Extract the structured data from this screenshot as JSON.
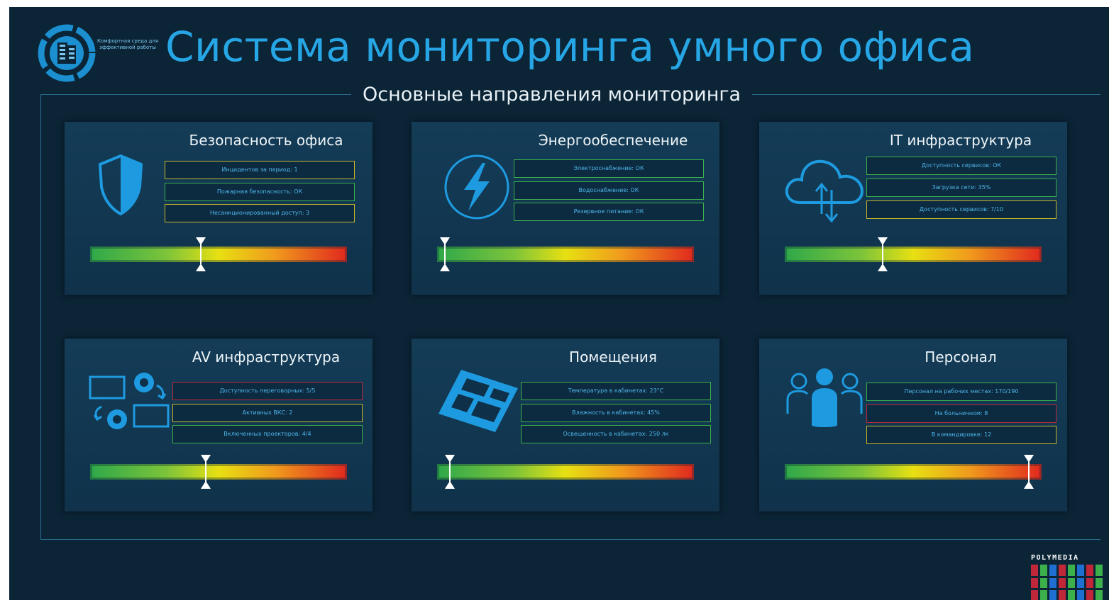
{
  "header": {
    "title": "Система мониторинга умного офиса",
    "subtitle": "Основные направления мониторинга",
    "logo_text": "Комфортная среда для эффективной работы"
  },
  "cards": [
    {
      "title": "Безопасность офиса",
      "icon": "shield-icon",
      "metrics": [
        {
          "text": "Инцидентов за период: 1",
          "status": "yellow"
        },
        {
          "text": "Пожарная безопасность: ОК",
          "status": "green"
        },
        {
          "text": "Несанкционированный доступ: 3",
          "status": "yellow"
        }
      ],
      "level": 0.43
    },
    {
      "title": "Энергообеспечение",
      "icon": "lightning-icon",
      "metrics": [
        {
          "text": "Электроснабжение: ОК",
          "status": "green"
        },
        {
          "text": "Водоснабжение: ОК",
          "status": "green"
        },
        {
          "text": "Резервное питание: ОК",
          "status": "green"
        }
      ],
      "level": 0.03
    },
    {
      "title": "IT инфраструктура",
      "icon": "cloud-sync-icon",
      "metrics": [
        {
          "text": "Доступность сервисов: ОК",
          "status": "green"
        },
        {
          "text": "Загрузка сети: 35%",
          "status": "green"
        },
        {
          "text": "Доступность сервисов: 7/10",
          "status": "yellow"
        }
      ],
      "level": 0.38
    },
    {
      "title": "AV инфраструктура",
      "icon": "av-devices-icon",
      "metrics": [
        {
          "text": "Доступность переговорных: 5/5",
          "status": "red"
        },
        {
          "text": "Активных ВКС: 2",
          "status": "yellow"
        },
        {
          "text": "Включенных проекторов: 4/4",
          "status": "green"
        }
      ],
      "level": 0.45
    },
    {
      "title": "Помещения",
      "icon": "floorplan-icon",
      "metrics": [
        {
          "text": "Температура в кабинетах: 23°C",
          "status": "green"
        },
        {
          "text": "Влажность в кабинетах: 45%",
          "status": "green"
        },
        {
          "text": "Освещенность в кабинетах: 250 лк",
          "status": "green"
        }
      ],
      "level": 0.05
    },
    {
      "title": "Персонал",
      "icon": "people-icon",
      "metrics": [
        {
          "text": "Персонал на рабочих местах: 170/190",
          "status": "green"
        },
        {
          "text": "На больничном: 8",
          "status": "red"
        },
        {
          "text": "В командировке: 12",
          "status": "yellow"
        }
      ],
      "level": 0.95
    }
  ],
  "status_colors": {
    "green": "#3cb04a",
    "yellow": "#c8b62a",
    "red": "#c0283a"
  },
  "footer": {
    "brand": "POLYMEDIA"
  }
}
